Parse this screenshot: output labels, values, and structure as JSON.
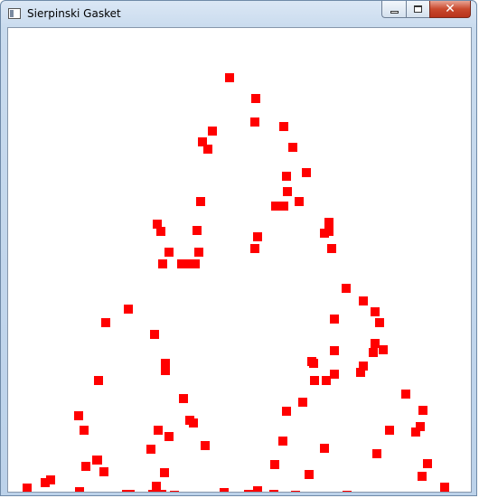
{
  "window": {
    "title": "Sierpinski Gasket",
    "icon": "app-window-icon"
  },
  "caption_buttons": {
    "minimize_icon": "minimize-icon",
    "maximize_icon": "maximize-icon",
    "close_icon": "close-icon",
    "close_glyph": "✕"
  },
  "colors": {
    "point": "#ff0000"
  }
}
